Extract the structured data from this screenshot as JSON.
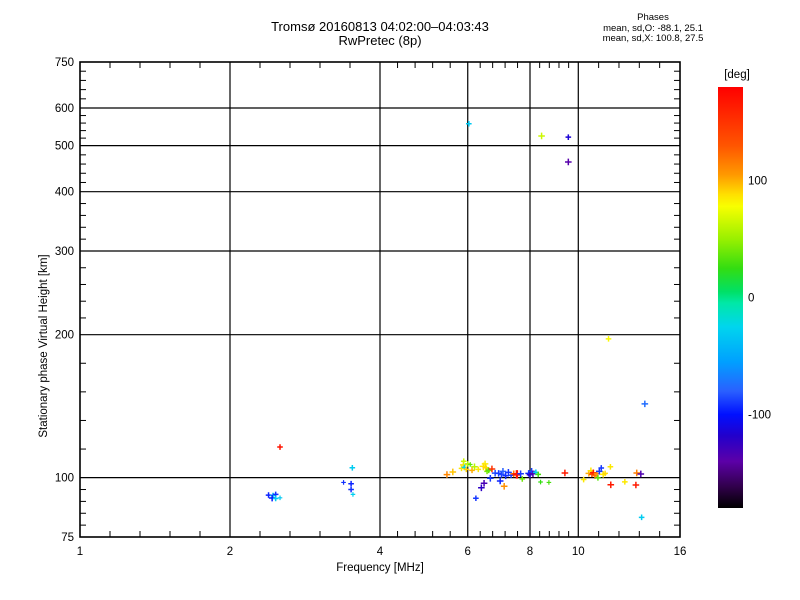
{
  "chart_data": {
    "type": "scatter",
    "title": "Tromsø 20160813 04:02:00–04:03:43",
    "subtitle": "RwPretec (8p)",
    "stats": {
      "heading": "Phases",
      "line_o": "mean, sd,O: -88.1, 25.1",
      "line_x": "mean, sd,X: 100.8, 27.5"
    },
    "xlabel": "Frequency [MHz]",
    "ylabel": "Stationary phase Virtual Height [km]",
    "x_scale": "log",
    "y_scale": "log",
    "xlim": [
      1,
      16
    ],
    "ylim": [
      75,
      750
    ],
    "x_ticks": [
      1,
      2,
      4,
      6,
      8,
      10,
      16
    ],
    "y_ticks": [
      75,
      100,
      200,
      300,
      400,
      500,
      600,
      750
    ],
    "x_gridlines": [
      2,
      4,
      6,
      8,
      10
    ],
    "y_gridlines": [
      100,
      200,
      300,
      400,
      500,
      600
    ],
    "grid": true,
    "colorbar": {
      "title": "[deg]",
      "range": [
        -180,
        180
      ],
      "ticks": [
        100,
        0,
        -100
      ],
      "colormap": [
        [
          180,
          "#ff0000"
        ],
        [
          130,
          "#ff5500"
        ],
        [
          105,
          "#ff9900"
        ],
        [
          88,
          "#ffe000"
        ],
        [
          78,
          "#f8ff00"
        ],
        [
          50,
          "#99f000"
        ],
        [
          25,
          "#33dd11"
        ],
        [
          5,
          "#00e066"
        ],
        [
          -5,
          "#00e8a8"
        ],
        [
          -25,
          "#00d5ee"
        ],
        [
          -55,
          "#00a0ff"
        ],
        [
          -80,
          "#2a60ff"
        ],
        [
          -100,
          "#0010ff"
        ],
        [
          -118,
          "#2200cc"
        ],
        [
          -140,
          "#5c00a8"
        ],
        [
          -162,
          "#30004a"
        ],
        [
          -180,
          "#000000"
        ]
      ]
    },
    "points_format": [
      "freq_MHz",
      "virtual_height_km",
      "phase_deg",
      "marker_size"
    ],
    "points": [
      [
        2.39,
        91.9,
        -95,
        4
      ],
      [
        2.44,
        91.7,
        -30,
        4
      ],
      [
        2.47,
        92.2,
        -92,
        4
      ],
      [
        2.43,
        90.6,
        -98,
        5
      ],
      [
        2.47,
        90.4,
        -30,
        4
      ],
      [
        2.52,
        90.7,
        -32,
        3
      ],
      [
        2.52,
        116.0,
        168,
        4
      ],
      [
        3.38,
        97.7,
        -92,
        3
      ],
      [
        3.52,
        104.9,
        -30,
        4
      ],
      [
        3.5,
        97.1,
        -95,
        4
      ],
      [
        3.5,
        94.4,
        -92,
        4
      ],
      [
        3.53,
        92.2,
        -28,
        3
      ],
      [
        6.03,
        556.0,
        -32,
        4
      ],
      [
        8.44,
        524.0,
        65,
        5
      ],
      [
        9.55,
        521.0,
        -115,
        4
      ],
      [
        9.55,
        462.0,
        -138,
        5
      ],
      [
        11.5,
        196.0,
        80,
        4
      ],
      [
        13.6,
        143.0,
        -75,
        5
      ],
      [
        13.4,
        82.5,
        -30,
        4
      ],
      [
        5.45,
        101.5,
        112,
        5
      ],
      [
        5.6,
        102.8,
        95,
        5
      ],
      [
        5.83,
        104.6,
        85,
        4
      ],
      [
        5.88,
        106.4,
        88,
        5
      ],
      [
        5.91,
        105.1,
        -25,
        4
      ],
      [
        5.89,
        108.3,
        65,
        4
      ],
      [
        5.96,
        104.1,
        92,
        4
      ],
      [
        6.0,
        106.9,
        58,
        4
      ],
      [
        6.07,
        106.6,
        35,
        3
      ],
      [
        6.12,
        103.6,
        100,
        4
      ],
      [
        6.19,
        105.4,
        60,
        5
      ],
      [
        6.23,
        90.5,
        -90,
        4
      ],
      [
        6.3,
        104.1,
        85,
        4
      ],
      [
        6.39,
        95.2,
        -122,
        5
      ],
      [
        6.45,
        105.6,
        88,
        6
      ],
      [
        6.47,
        97.3,
        -132,
        5
      ],
      [
        6.5,
        106.9,
        85,
        5
      ],
      [
        6.52,
        104.9,
        90,
        5
      ],
      [
        6.56,
        103.1,
        42,
        4
      ],
      [
        6.61,
        103.6,
        35,
        4
      ],
      [
        6.66,
        99.7,
        -90,
        5
      ],
      [
        6.71,
        104.3,
        150,
        5
      ],
      [
        6.81,
        102.2,
        -85,
        5
      ],
      [
        6.92,
        102.1,
        -90,
        5
      ],
      [
        6.97,
        98.4,
        -95,
        5
      ],
      [
        7.01,
        101.6,
        -88,
        5
      ],
      [
        7.06,
        103.1,
        -80,
        5
      ],
      [
        7.1,
        95.9,
        108,
        5
      ],
      [
        7.15,
        100.9,
        -92,
        5
      ],
      [
        7.24,
        102.6,
        -90,
        5
      ],
      [
        7.33,
        101.2,
        -88,
        4
      ],
      [
        7.42,
        101.9,
        115,
        5
      ],
      [
        7.53,
        101.6,
        168,
        7
      ],
      [
        7.66,
        101.9,
        -90,
        5
      ],
      [
        7.72,
        99.4,
        40,
        4
      ],
      [
        7.95,
        102.1,
        -95,
        5
      ],
      [
        8.0,
        101.4,
        -120,
        5
      ],
      [
        8.06,
        103.1,
        -88,
        5
      ],
      [
        8.11,
        101.9,
        -135,
        5
      ],
      [
        8.22,
        102.6,
        -30,
        4
      ],
      [
        8.31,
        101.6,
        30,
        4
      ],
      [
        8.4,
        97.9,
        25,
        3
      ],
      [
        8.73,
        97.7,
        30,
        3
      ],
      [
        9.4,
        102.3,
        165,
        5
      ],
      [
        10.25,
        99.1,
        85,
        4
      ],
      [
        10.5,
        102.1,
        100,
        5
      ],
      [
        10.6,
        103.4,
        85,
        5
      ],
      [
        10.65,
        101.6,
        140,
        4
      ],
      [
        10.72,
        102.4,
        165,
        5
      ],
      [
        10.8,
        101.0,
        120,
        5
      ],
      [
        10.9,
        101.9,
        110,
        5
      ],
      [
        10.95,
        99.9,
        35,
        4
      ],
      [
        11.02,
        103.1,
        -90,
        5
      ],
      [
        11.12,
        104.8,
        -90,
        4
      ],
      [
        11.22,
        101.6,
        85,
        5
      ],
      [
        11.32,
        102.1,
        90,
        4
      ],
      [
        11.6,
        105.4,
        85,
        4
      ],
      [
        11.62,
        96.6,
        165,
        5
      ],
      [
        12.4,
        98.0,
        85,
        4
      ],
      [
        13.05,
        96.5,
        165,
        5
      ],
      [
        13.1,
        102.3,
        115,
        5
      ],
      [
        13.35,
        101.8,
        -135,
        5
      ]
    ]
  }
}
